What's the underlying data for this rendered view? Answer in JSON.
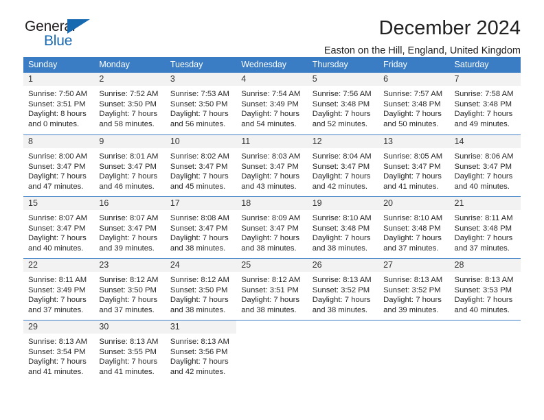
{
  "logo": {
    "word_general": "General",
    "word_blue": "Blue",
    "triangle_color": "#1769b0"
  },
  "header": {
    "month_title": "December 2024",
    "location": "Easton on the Hill, England, United Kingdom"
  },
  "calendar": {
    "header_color": "#3a7dc4",
    "day_headers": [
      "Sunday",
      "Monday",
      "Tuesday",
      "Wednesday",
      "Thursday",
      "Friday",
      "Saturday"
    ],
    "weeks": [
      [
        {
          "day": "1",
          "sunrise": "Sunrise: 7:50 AM",
          "sunset": "Sunset: 3:51 PM",
          "daylight_line1": "Daylight: 8 hours",
          "daylight_line2": "and 0 minutes."
        },
        {
          "day": "2",
          "sunrise": "Sunrise: 7:52 AM",
          "sunset": "Sunset: 3:50 PM",
          "daylight_line1": "Daylight: 7 hours",
          "daylight_line2": "and 58 minutes."
        },
        {
          "day": "3",
          "sunrise": "Sunrise: 7:53 AM",
          "sunset": "Sunset: 3:50 PM",
          "daylight_line1": "Daylight: 7 hours",
          "daylight_line2": "and 56 minutes."
        },
        {
          "day": "4",
          "sunrise": "Sunrise: 7:54 AM",
          "sunset": "Sunset: 3:49 PM",
          "daylight_line1": "Daylight: 7 hours",
          "daylight_line2": "and 54 minutes."
        },
        {
          "day": "5",
          "sunrise": "Sunrise: 7:56 AM",
          "sunset": "Sunset: 3:48 PM",
          "daylight_line1": "Daylight: 7 hours",
          "daylight_line2": "and 52 minutes."
        },
        {
          "day": "6",
          "sunrise": "Sunrise: 7:57 AM",
          "sunset": "Sunset: 3:48 PM",
          "daylight_line1": "Daylight: 7 hours",
          "daylight_line2": "and 50 minutes."
        },
        {
          "day": "7",
          "sunrise": "Sunrise: 7:58 AM",
          "sunset": "Sunset: 3:48 PM",
          "daylight_line1": "Daylight: 7 hours",
          "daylight_line2": "and 49 minutes."
        }
      ],
      [
        {
          "day": "8",
          "sunrise": "Sunrise: 8:00 AM",
          "sunset": "Sunset: 3:47 PM",
          "daylight_line1": "Daylight: 7 hours",
          "daylight_line2": "and 47 minutes."
        },
        {
          "day": "9",
          "sunrise": "Sunrise: 8:01 AM",
          "sunset": "Sunset: 3:47 PM",
          "daylight_line1": "Daylight: 7 hours",
          "daylight_line2": "and 46 minutes."
        },
        {
          "day": "10",
          "sunrise": "Sunrise: 8:02 AM",
          "sunset": "Sunset: 3:47 PM",
          "daylight_line1": "Daylight: 7 hours",
          "daylight_line2": "and 45 minutes."
        },
        {
          "day": "11",
          "sunrise": "Sunrise: 8:03 AM",
          "sunset": "Sunset: 3:47 PM",
          "daylight_line1": "Daylight: 7 hours",
          "daylight_line2": "and 43 minutes."
        },
        {
          "day": "12",
          "sunrise": "Sunrise: 8:04 AM",
          "sunset": "Sunset: 3:47 PM",
          "daylight_line1": "Daylight: 7 hours",
          "daylight_line2": "and 42 minutes."
        },
        {
          "day": "13",
          "sunrise": "Sunrise: 8:05 AM",
          "sunset": "Sunset: 3:47 PM",
          "daylight_line1": "Daylight: 7 hours",
          "daylight_line2": "and 41 minutes."
        },
        {
          "day": "14",
          "sunrise": "Sunrise: 8:06 AM",
          "sunset": "Sunset: 3:47 PM",
          "daylight_line1": "Daylight: 7 hours",
          "daylight_line2": "and 40 minutes."
        }
      ],
      [
        {
          "day": "15",
          "sunrise": "Sunrise: 8:07 AM",
          "sunset": "Sunset: 3:47 PM",
          "daylight_line1": "Daylight: 7 hours",
          "daylight_line2": "and 40 minutes."
        },
        {
          "day": "16",
          "sunrise": "Sunrise: 8:07 AM",
          "sunset": "Sunset: 3:47 PM",
          "daylight_line1": "Daylight: 7 hours",
          "daylight_line2": "and 39 minutes."
        },
        {
          "day": "17",
          "sunrise": "Sunrise: 8:08 AM",
          "sunset": "Sunset: 3:47 PM",
          "daylight_line1": "Daylight: 7 hours",
          "daylight_line2": "and 38 minutes."
        },
        {
          "day": "18",
          "sunrise": "Sunrise: 8:09 AM",
          "sunset": "Sunset: 3:47 PM",
          "daylight_line1": "Daylight: 7 hours",
          "daylight_line2": "and 38 minutes."
        },
        {
          "day": "19",
          "sunrise": "Sunrise: 8:10 AM",
          "sunset": "Sunset: 3:48 PM",
          "daylight_line1": "Daylight: 7 hours",
          "daylight_line2": "and 38 minutes."
        },
        {
          "day": "20",
          "sunrise": "Sunrise: 8:10 AM",
          "sunset": "Sunset: 3:48 PM",
          "daylight_line1": "Daylight: 7 hours",
          "daylight_line2": "and 37 minutes."
        },
        {
          "day": "21",
          "sunrise": "Sunrise: 8:11 AM",
          "sunset": "Sunset: 3:48 PM",
          "daylight_line1": "Daylight: 7 hours",
          "daylight_line2": "and 37 minutes."
        }
      ],
      [
        {
          "day": "22",
          "sunrise": "Sunrise: 8:11 AM",
          "sunset": "Sunset: 3:49 PM",
          "daylight_line1": "Daylight: 7 hours",
          "daylight_line2": "and 37 minutes."
        },
        {
          "day": "23",
          "sunrise": "Sunrise: 8:12 AM",
          "sunset": "Sunset: 3:50 PM",
          "daylight_line1": "Daylight: 7 hours",
          "daylight_line2": "and 37 minutes."
        },
        {
          "day": "24",
          "sunrise": "Sunrise: 8:12 AM",
          "sunset": "Sunset: 3:50 PM",
          "daylight_line1": "Daylight: 7 hours",
          "daylight_line2": "and 38 minutes."
        },
        {
          "day": "25",
          "sunrise": "Sunrise: 8:12 AM",
          "sunset": "Sunset: 3:51 PM",
          "daylight_line1": "Daylight: 7 hours",
          "daylight_line2": "and 38 minutes."
        },
        {
          "day": "26",
          "sunrise": "Sunrise: 8:13 AM",
          "sunset": "Sunset: 3:52 PM",
          "daylight_line1": "Daylight: 7 hours",
          "daylight_line2": "and 38 minutes."
        },
        {
          "day": "27",
          "sunrise": "Sunrise: 8:13 AM",
          "sunset": "Sunset: 3:52 PM",
          "daylight_line1": "Daylight: 7 hours",
          "daylight_line2": "and 39 minutes."
        },
        {
          "day": "28",
          "sunrise": "Sunrise: 8:13 AM",
          "sunset": "Sunset: 3:53 PM",
          "daylight_line1": "Daylight: 7 hours",
          "daylight_line2": "and 40 minutes."
        }
      ],
      [
        {
          "day": "29",
          "sunrise": "Sunrise: 8:13 AM",
          "sunset": "Sunset: 3:54 PM",
          "daylight_line1": "Daylight: 7 hours",
          "daylight_line2": "and 41 minutes."
        },
        {
          "day": "30",
          "sunrise": "Sunrise: 8:13 AM",
          "sunset": "Sunset: 3:55 PM",
          "daylight_line1": "Daylight: 7 hours",
          "daylight_line2": "and 41 minutes."
        },
        {
          "day": "31",
          "sunrise": "Sunrise: 8:13 AM",
          "sunset": "Sunset: 3:56 PM",
          "daylight_line1": "Daylight: 7 hours",
          "daylight_line2": "and 42 minutes."
        },
        {
          "day": "",
          "sunrise": "",
          "sunset": "",
          "daylight_line1": "",
          "daylight_line2": ""
        },
        {
          "day": "",
          "sunrise": "",
          "sunset": "",
          "daylight_line1": "",
          "daylight_line2": ""
        },
        {
          "day": "",
          "sunrise": "",
          "sunset": "",
          "daylight_line1": "",
          "daylight_line2": ""
        },
        {
          "day": "",
          "sunrise": "",
          "sunset": "",
          "daylight_line1": "",
          "daylight_line2": ""
        }
      ]
    ]
  }
}
